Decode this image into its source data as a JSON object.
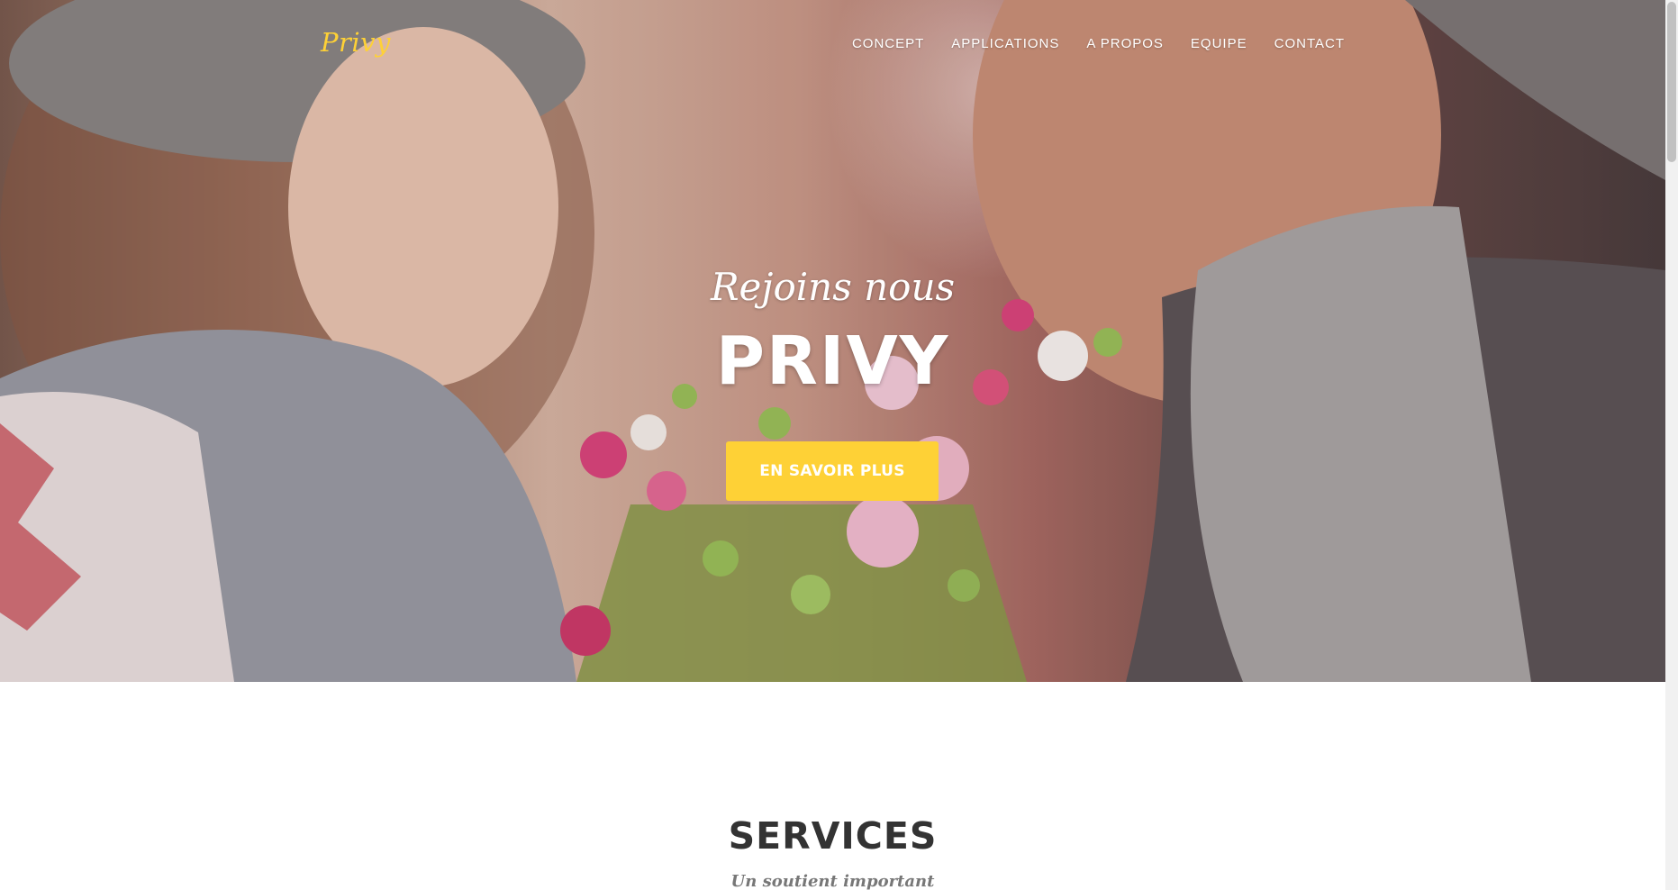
{
  "brand": {
    "name": "Privy",
    "color": "#fed136"
  },
  "nav": {
    "items": [
      {
        "label": "CONCEPT"
      },
      {
        "label": "APPLICATIONS"
      },
      {
        "label": "A PROPOS"
      },
      {
        "label": "EQUIPE"
      },
      {
        "label": "CONTACT"
      }
    ]
  },
  "hero": {
    "lead": "Rejoins nous",
    "heading": "PRIVY",
    "cta_label": "EN SAVOIR PLUS",
    "image_description_icon": "couple-with-flowers-photo"
  },
  "services": {
    "heading": "SERVICES",
    "subheading": "Un soutient important"
  },
  "colors": {
    "accent": "#fed136",
    "heading_text": "#333333",
    "subheading_text": "#777777"
  }
}
